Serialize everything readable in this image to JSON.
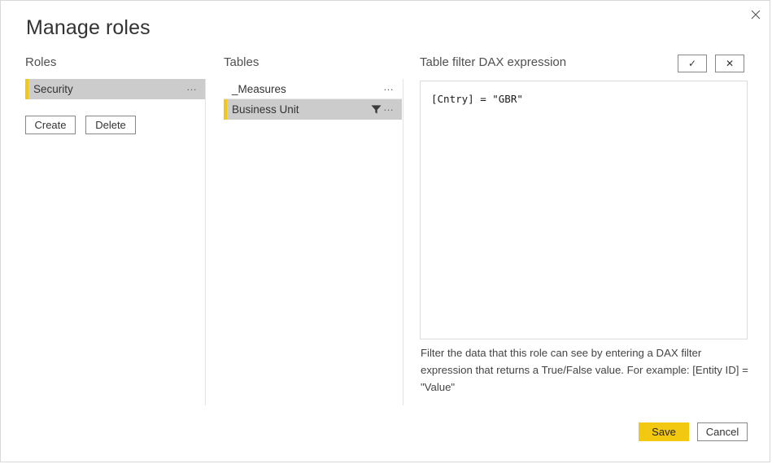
{
  "dialog": {
    "title": "Manage roles",
    "close_label": "×"
  },
  "roles": {
    "heading": "Roles",
    "items": [
      {
        "label": "Security",
        "selected": true,
        "menu": "…"
      }
    ],
    "create_label": "Create",
    "delete_label": "Delete"
  },
  "tables": {
    "heading": "Tables",
    "items": [
      {
        "label": "_Measures",
        "selected": false,
        "filtered": false,
        "menu": "…"
      },
      {
        "label": "Business Unit",
        "selected": true,
        "filtered": true,
        "menu": "…"
      }
    ]
  },
  "dax": {
    "heading": "Table filter DAX expression",
    "accept_glyph": "✓",
    "revert_glyph": "✕",
    "expression": "[Cntry] = \"GBR\"",
    "help_text": "Filter the data that this role can see by entering a DAX filter expression that returns a True/False value. For example: [Entity ID] = \"Value\""
  },
  "footer": {
    "save_label": "Save",
    "cancel_label": "Cancel"
  },
  "colors": {
    "accent_yellow": "#f2c811",
    "selected_row": "#cccccc",
    "divider": "#e3e3e3",
    "text_primary": "#333333"
  }
}
